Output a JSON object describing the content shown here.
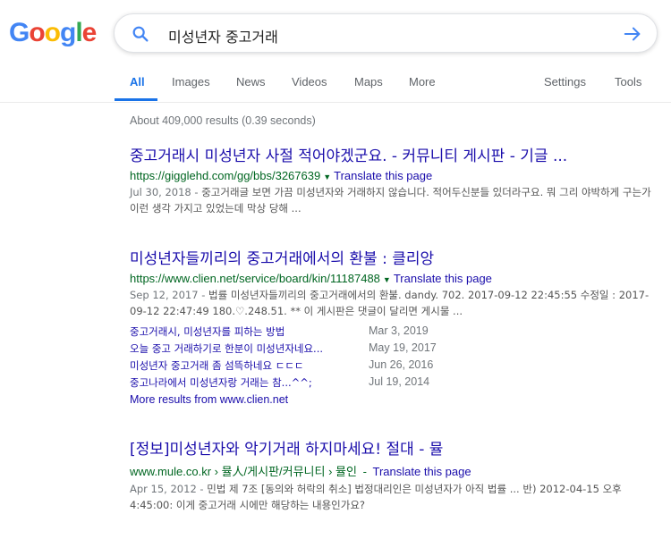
{
  "logo": {
    "text": "Google",
    "letters": [
      "G",
      "o",
      "o",
      "g",
      "l",
      "e"
    ],
    "colors": [
      "#4285F4",
      "#EA4335",
      "#FBBC05",
      "#4285F4",
      "#34A853",
      "#EA4335"
    ]
  },
  "search": {
    "query": "미성년자 중고거래"
  },
  "tabs": [
    {
      "label": "All",
      "active": true
    },
    {
      "label": "Images"
    },
    {
      "label": "News"
    },
    {
      "label": "Videos"
    },
    {
      "label": "Maps"
    },
    {
      "label": "More"
    }
  ],
  "tools": {
    "settings": "Settings",
    "tools": "Tools"
  },
  "stats": "About 409,000 results (0.39 seconds)",
  "results": [
    {
      "title": "중고거래시 미성년자 사절 적어야겠군요. - 커뮤니티 게시판 - 기글 ...",
      "url": "https://gigglehd.com/gg/bbs/3267639",
      "translate": "Translate this page",
      "date": "Jul 30, 2018 - ",
      "snippet": "중고거래글 보면 가끔 미성년자와 거래하지 않습니다. 적어두신분들 있더라구요. 뭐 그리 야박하게 구는가 이런 생각 가지고 있었는데 막상 당해 ..."
    },
    {
      "title": "미성년자들끼리의 중고거래에서의 환불 : 클리앙",
      "url": "https://www.clien.net/service/board/kin/11187488",
      "translate": "Translate this page",
      "date": "Sep 12, 2017 - ",
      "snippet": "법률 미성년자들끼리의 중고거래에서의 환불. dandy. 702. 2017-09-12 22:45:55 수정일 : 2017-09-12 22:47:49 180.♡.248.51. ** 이 게시판은 댓글이 달리면 게시물 ...",
      "sitelinks": [
        {
          "label": "중고거래시, 미성년자를 피하는 방법",
          "date": "Mar 3, 2019"
        },
        {
          "label": "오늘 중고 거래하기로 한분이 미성년자네요...",
          "date": "May 19, 2017"
        },
        {
          "label": "미성년자 중고거래 좀 섬뜩하네요 ㄷㄷㄷ",
          "date": "Jun 26, 2016"
        },
        {
          "label": "중고나라에서 미성년자랑 거래는 참...^^;",
          "date": "Jul 19, 2014"
        }
      ],
      "more": "More results from www.clien.net"
    },
    {
      "title": "[정보]미성년자와 악기거래 하지마세요! 절대 - 뮬",
      "url": "www.mule.co.kr › 뮬人/게시판/커뮤니티 › 뮬인",
      "translate": "Translate this page",
      "date": "Apr 15, 2012 - ",
      "snippet": "민법 제 7조 [동의와 허락의 취소] 법정대리인은 미성년자가 아직 법률 ... 반) 2012-04-15 오후 4:45:00: 이게 중고거래 시에만 해당하는 내용인가요?"
    }
  ]
}
